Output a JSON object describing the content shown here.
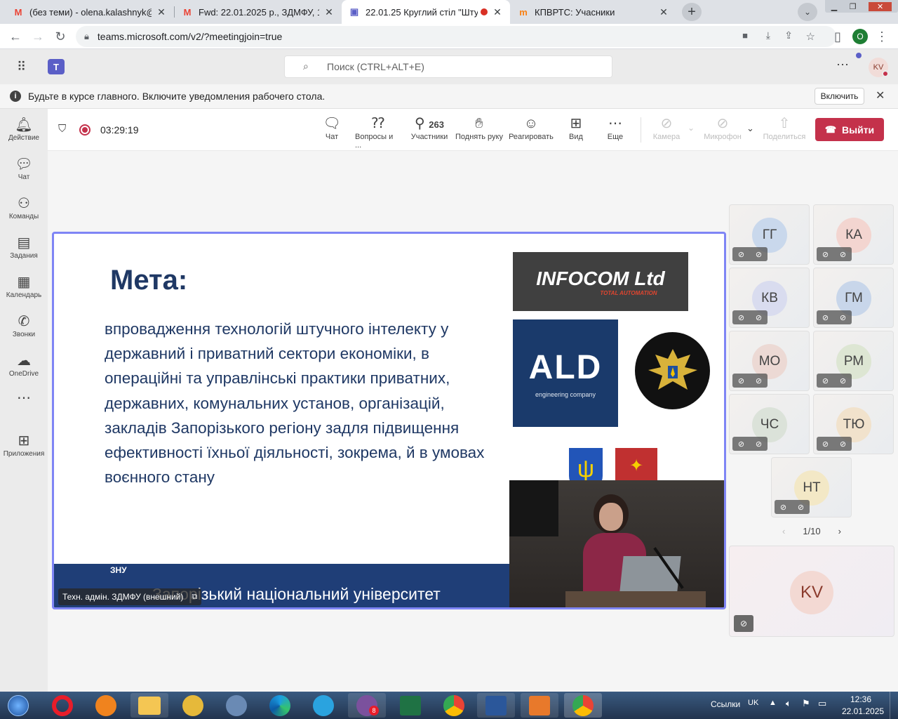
{
  "browser": {
    "tabs": [
      {
        "title": "(без теми) - olena.kalashnyk@pc",
        "favicon": "gmail-icon",
        "active": false
      },
      {
        "title": "Fwd: 22.01.2025 р., ЗДМФУ, 12:0",
        "favicon": "gmail-icon",
        "active": false
      },
      {
        "title": "22.01.25 Круглий стіл \"Штуч",
        "favicon": "teams-icon",
        "active": true
      },
      {
        "title": "КПВРТС: Учасники",
        "favicon": "moodle-icon",
        "active": false
      }
    ],
    "url": "teams.microsoft.com/v2/?meetingjoin=true",
    "profile_initial": "O"
  },
  "teams": {
    "search_placeholder": "Поиск (CTRL+ALT+E)",
    "avatar_initials": "KV",
    "notification": {
      "text": "Будьте в курсе главного. Включите уведомления рабочего стола.",
      "button": "Включить"
    },
    "rail": [
      {
        "label": "Действие",
        "icon": "bell-icon"
      },
      {
        "label": "Чат",
        "icon": "chat-icon"
      },
      {
        "label": "Команды",
        "icon": "teams-group-icon"
      },
      {
        "label": "Задания",
        "icon": "backpack-icon"
      },
      {
        "label": "Календарь",
        "icon": "calendar-icon"
      },
      {
        "label": "Звонки",
        "icon": "phone-icon"
      },
      {
        "label": "OneDrive",
        "icon": "cloud-icon"
      },
      {
        "label": "Приложения",
        "icon": "plus-box-icon"
      }
    ],
    "meeting": {
      "timer": "03:29:19",
      "participants_count": "263",
      "buttons": {
        "chat": "Чат",
        "qa": "Вопросы и ...",
        "participants": "Участники",
        "raise_hand": "Поднять руку",
        "react": "Реагировать",
        "view": "Вид",
        "more": "Еще",
        "camera": "Камера",
        "mic": "Микрофон",
        "share": "Поделиться",
        "leave": "Выйти"
      },
      "presenter_label": "Техн. адмін. ЗДМФУ (внешний)",
      "pagination": "1/10",
      "self_initials": "KV"
    },
    "slide": {
      "title": "Мета:",
      "body": "впровадження технологій штучного інтелекту у державний і приватний сектори економіки, в операційні та управлінські практики приватних, державних, комунальних установ, організацій, закладів Запорізького регіону задля підвищення ефективності їхньої діяльності, зокрема, й в умовах воєнного стану",
      "footer": "Запорізький національний університет",
      "logo_infocom": "INFOCOM Ltd",
      "logo_infocom_sub": "TOTAL AUTOMATION",
      "logo_ald": "ALD",
      "logo_ald_sub": "engineering company",
      "logo_znu": "ЗНУ"
    },
    "participants": [
      {
        "initials": "ГГ",
        "color": "#c9d8ec"
      },
      {
        "initials": "КА",
        "color": "#f3d5d0"
      },
      {
        "initials": "КВ",
        "color": "#d9dcef"
      },
      {
        "initials": "ГМ",
        "color": "#c8d6ea"
      },
      {
        "initials": "МО",
        "color": "#ecd9d4"
      },
      {
        "initials": "РМ",
        "color": "#dde6d3"
      },
      {
        "initials": "ЧС",
        "color": "#dbe2d9"
      },
      {
        "initials": "ТЮ",
        "color": "#f1e2cc"
      },
      {
        "initials": "НТ",
        "color": "#f3e8c6"
      }
    ]
  },
  "taskbar": {
    "links_label": "Ссылки",
    "lang": "UK",
    "time": "12:36",
    "date": "22.01.2025",
    "viber_badge": "8"
  }
}
